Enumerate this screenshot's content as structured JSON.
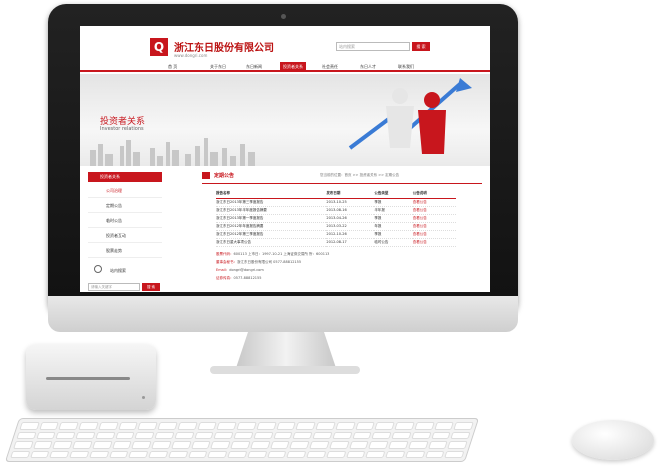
{
  "company": {
    "name": "浙江东日股份有限公司",
    "url": "www.dongri.com",
    "logo_letter": "Q"
  },
  "search": {
    "placeholder": "站内搜索",
    "button": "搜 索"
  },
  "nav": {
    "items": [
      "首 页",
      "关于东日",
      "东日新闻",
      "投资者关系",
      "社会责任",
      "东日人才",
      "联系我们",
      "网站地图"
    ],
    "active_index": 3
  },
  "banner": {
    "title_cn": "投资者关系",
    "title_en": "Investor relations"
  },
  "sidebar": {
    "title": "投资者关系",
    "items": [
      "公司治理",
      "定期公告",
      "临时公告",
      "投资者互动",
      "股票走势"
    ],
    "active_index": 0,
    "search_label": "站内搜索",
    "search_placeholder": "请输入关键字",
    "search_button": "搜 索"
  },
  "main": {
    "title": "定期公告",
    "breadcrumb": "您当前的位置：首页 >> 投资者关系 >> 定期公告",
    "table": {
      "headers": [
        "报告名称",
        "发布日期",
        "公告类型",
        "公告说明"
      ],
      "rows": [
        [
          "浙江东日2013年第三季度报告",
          "2013-10-25",
          "季报",
          "查看公告"
        ],
        [
          "浙江东日2013年半年度报告摘要",
          "2013-08-16",
          "半年报",
          "查看公告"
        ],
        [
          "浙江东日2013年第一季度报告",
          "2013-04-26",
          "季报",
          "查看公告"
        ],
        [
          "浙江东日2012年年度报告摘要",
          "2013-03-22",
          "年报",
          "查看公告"
        ],
        [
          "浙江东日2012年第三季度报告",
          "2012-10-26",
          "季报",
          "查看公告"
        ],
        [
          "浙江东日重大事项公告",
          "2012-08-17",
          "临时公告",
          "查看公告"
        ]
      ]
    },
    "info": [
      {
        "label": "股票代码：",
        "text": "600113 上市日：1997-10-21 上海证券交易所 所：600113"
      },
      {
        "label": "董事会秘书：",
        "text": "浙江东日股份有限公司 0577-88812155"
      },
      {
        "label": "Email：",
        "text": "dongri@dongri.com"
      },
      {
        "label": "证券传真：",
        "text": "0577-88812155"
      }
    ]
  },
  "colors": {
    "brand_red": "#c8161d"
  }
}
